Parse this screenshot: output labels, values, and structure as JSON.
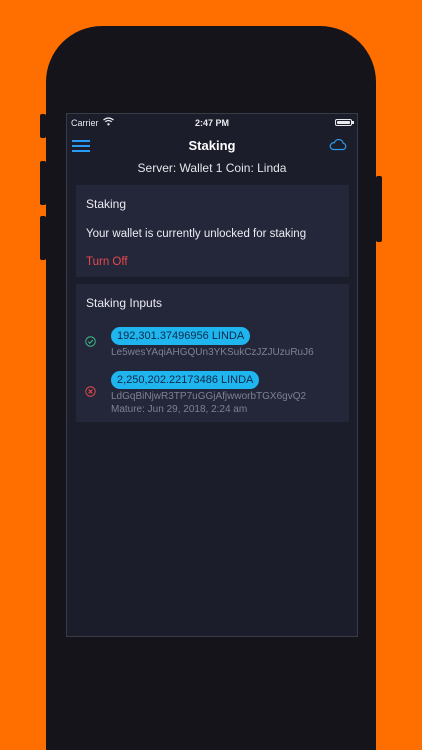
{
  "statusbar": {
    "carrier": "Carrier",
    "time": "2:47 PM"
  },
  "navbar": {
    "title": "Staking",
    "menu_icon": "hamburger-menu-icon",
    "cloud_icon": "cloud-icon"
  },
  "server_line": "Server: Wallet 1 Coin: Linda",
  "staking_card": {
    "title": "Staking",
    "message": "Your wallet is currently unlocked for staking",
    "action_label": "Turn Off"
  },
  "inputs_card": {
    "title": "Staking Inputs",
    "items": [
      {
        "amount": "192,301.37496956 LINDA",
        "address": "Le5wesYAqiAHGQUn3YKSukCzJZJUzuRuJ6",
        "status": "confirmed",
        "status_icon": "check-circle-icon",
        "status_color": "#3bc48a"
      },
      {
        "amount": "2,250,202.22173486 LINDA",
        "address": "LdGqBiNjwR3TP7uGGjAfjwworbTGX6gvQ2",
        "mature": "Mature: Jun 29, 2018, 2:24 am",
        "status": "immature",
        "status_icon": "x-circle-icon",
        "status_color": "#e84b4b"
      }
    ]
  },
  "colors": {
    "background": "#ff6f00",
    "accent": "#2a9bf2",
    "pill": "#1fb6ef",
    "danger": "#e84b4b",
    "success": "#3bc48a"
  }
}
